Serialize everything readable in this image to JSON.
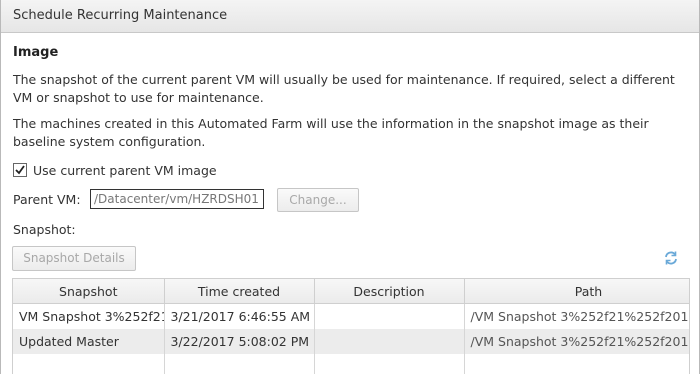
{
  "dialog": {
    "title": "Schedule Recurring Maintenance"
  },
  "image": {
    "section_title": "Image",
    "paragraph1": "The snapshot of the current parent VM will usually be used for maintenance. If required, select a different VM or snapshot to use for maintenance.",
    "paragraph2": "The machines created in this Automated Farm will use the information in the snapshot image as their baseline system configuration.",
    "use_current_label": "Use current parent VM image",
    "use_current_checked": true,
    "parent_vm_label": "Parent VM:",
    "parent_vm_value": "/Datacenter/vm/HZRDSH01",
    "change_button": "Change...",
    "snapshot_label": "Snapshot:",
    "snapshot_details_button": "Snapshot Details",
    "refresh_icon": "refresh-icon"
  },
  "table": {
    "headers": [
      "Snapshot",
      "Time created",
      "Description",
      "Path"
    ],
    "rows": [
      [
        "VM Snapshot 3%252f21",
        "3/21/2017 6:46:55 AM",
        "",
        "/VM Snapshot 3%252f21%252f201"
      ],
      [
        "Updated Master",
        "3/22/2017 5:08:02 PM",
        "",
        "/VM Snapshot 3%252f21%252f201"
      ]
    ]
  },
  "colors": {
    "titlebar": "#e6e6e6",
    "disabled_text": "#a8a8a8",
    "refresh_blue": "#6aa9d8"
  }
}
